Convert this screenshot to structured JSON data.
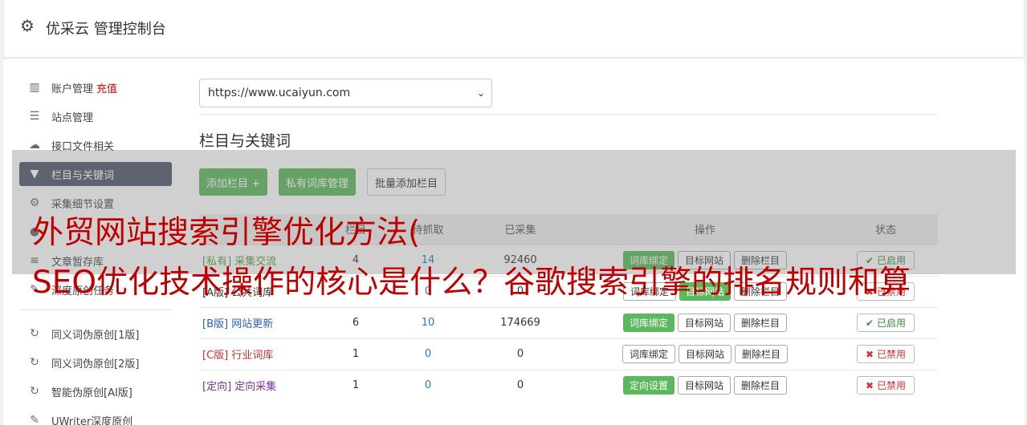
{
  "app": {
    "title": "优采云 管理控制台"
  },
  "sidebar": {
    "items": [
      {
        "label": "账户管理",
        "extra": "充值",
        "icon": "bar-chart-icon"
      },
      {
        "label": "站点管理",
        "icon": "server-icon"
      },
      {
        "label": "接口文件相关",
        "icon": "cloud-upload-icon"
      },
      {
        "label": "栏目与关键词",
        "icon": "filter-icon"
      },
      {
        "label": "采集细节设置",
        "icon": "cogs-icon"
      },
      {
        "label": "",
        "icon": "globe-icon"
      },
      {
        "label": "文章暂存库",
        "icon": "database-icon"
      },
      {
        "label": "深度原创任务",
        "icon": "edit-icon"
      }
    ],
    "tools": [
      {
        "label": "同义词伪原创[1版]",
        "icon": "refresh-icon"
      },
      {
        "label": "同义词伪原创[2版]",
        "icon": "refresh-icon"
      },
      {
        "label": "智能伪原创[AI版]",
        "icon": "refresh-icon"
      },
      {
        "label": "UWriter深度原创",
        "icon": "edit-icon"
      }
    ]
  },
  "site_select": {
    "value": "https://www.ucaiyun.com"
  },
  "section": {
    "title": "栏目与关键词"
  },
  "actions": {
    "add_column": "添加栏目 +",
    "private_lib": "私有词库管理",
    "batch_add": "批量添加栏目"
  },
  "table": {
    "headers": [
      "",
      "栏目",
      "待抓取",
      "已采集",
      "操作",
      "状态"
    ],
    "rows": [
      {
        "name": "[私有] 采集交流",
        "col": "4",
        "pending": "14",
        "collected": "92460",
        "op1": "词库绑定",
        "op2": "目标网站",
        "op3": "删除栏目",
        "status": "已启用"
      },
      {
        "name": "[A版] 公共词库",
        "col": "",
        "pending": "0",
        "collected": "0",
        "op1": "词库绑定",
        "op2": "目标网站",
        "op3": "删除栏目",
        "status": "已禁用"
      },
      {
        "name": "[B版] 网站更新",
        "col": "6",
        "pending": "10",
        "collected": "174669",
        "op1": "词库绑定",
        "op2": "目标网站",
        "op3": "删除栏目",
        "status": "已启用"
      },
      {
        "name": "[C版] 行业词库",
        "col": "1",
        "pending": "0",
        "collected": "0",
        "op1": "词库绑定",
        "op2": "目标网站",
        "op3": "删除栏目",
        "status": "已禁用"
      },
      {
        "name": "[定向] 定向采集",
        "col": "1",
        "pending": "0",
        "collected": "0",
        "op1": "定向设置",
        "op2": "目标网站",
        "op3": "删除栏目",
        "status": "已禁用"
      }
    ]
  },
  "overlay": {
    "line1": "外贸网站搜索引擎优化方法(",
    "line2": "SEO优化技术操作的核心是什么？谷歌搜索引擎的排名规则和算"
  },
  "colors": {
    "accent_green": "#5cb85c",
    "active_nav": "#51596a",
    "headline_red": "#c00000"
  }
}
